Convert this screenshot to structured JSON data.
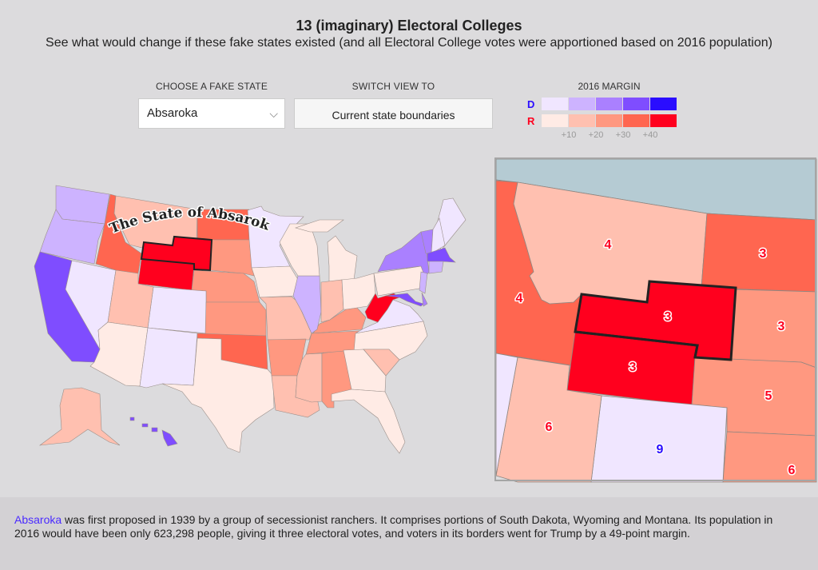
{
  "header": {
    "title": "13 (imaginary) Electoral Colleges",
    "subtitle": "See what would change if these fake states existed (and all Electoral College votes were apportioned based on 2016 population)"
  },
  "controls": {
    "choose_label": "CHOOSE A FAKE STATE",
    "choose_value": "Absaroka",
    "switch_label": "SWITCH VIEW TO",
    "switch_button": "Current state boundaries"
  },
  "legend": {
    "title": "2016 MARGIN",
    "d_label": "D",
    "r_label": "R",
    "d_colors": [
      "#f0e6ff",
      "#cdb3ff",
      "#aa80ff",
      "#7f4dff",
      "#2a0dff"
    ],
    "r_colors": [
      "#ffebe5",
      "#ffc0b0",
      "#ff9880",
      "#ff6650",
      "#ff001e"
    ],
    "ticks": [
      "+10",
      "+20",
      "+30",
      "+40"
    ]
  },
  "map": {
    "fake_state_label": "The State of Absaroka",
    "state_margins": {
      "WA": "D2",
      "OR": "D2",
      "CA": "D4",
      "NV": "D1",
      "ID": "R4",
      "MT": "R2",
      "ABS": "R5",
      "WY": "R5",
      "ND": "R4",
      "SD": "R3",
      "NE": "R3",
      "CO": "D1",
      "UT": "R2",
      "AZ": "R1",
      "NM": "D1",
      "KS": "R3",
      "OK": "R4",
      "TX": "R1",
      "MN": "D1",
      "IA": "R1",
      "MO": "R2",
      "AR": "R3",
      "LA": "R2",
      "MS": "R2",
      "AL": "R3",
      "TN": "R3",
      "KY": "R3",
      "IL": "D2",
      "WI": "R1",
      "MI": "R1",
      "IN": "R2",
      "OH": "R1",
      "WV": "R5",
      "VA": "D1",
      "NC": "R1",
      "SC": "R2",
      "GA": "R1",
      "FL": "R1",
      "PA": "R1",
      "NY": "D3",
      "VT": "D3",
      "NH": "D1",
      "ME": "D1",
      "MA": "D4",
      "CT": "D2",
      "NJ": "D2",
      "MD": "D4",
      "DE": "D3",
      "AK": "R2",
      "HI": "D4"
    }
  },
  "inset": {
    "votes": [
      {
        "state": "Montana",
        "value": "4",
        "party": "R"
      },
      {
        "state": "North Dakota",
        "value": "3",
        "party": "R"
      },
      {
        "state": "Idaho",
        "value": "4",
        "party": "R"
      },
      {
        "state": "Absaroka",
        "value": "3",
        "party": "R"
      },
      {
        "state": "Wyoming",
        "value": "3",
        "party": "R"
      },
      {
        "state": "South Dakota",
        "value": "3",
        "party": "R"
      },
      {
        "state": "Nebraska",
        "value": "5",
        "party": "R"
      },
      {
        "state": "Utah",
        "value": "6",
        "party": "R"
      },
      {
        "state": "Colorado",
        "value": "9",
        "party": "D"
      },
      {
        "state": "Kansas",
        "value": "6",
        "party": "R"
      }
    ]
  },
  "description": {
    "highlight": "Absaroka",
    "text": " was first proposed in 1939 by a group of secessionist ranchers. It comprises portions of South Dakota, Wyoming and Montana. Its population in 2016 would have been only 623,298 people, giving it three electoral votes, and voters in its borders went for Trump by a 49-point margin."
  }
}
